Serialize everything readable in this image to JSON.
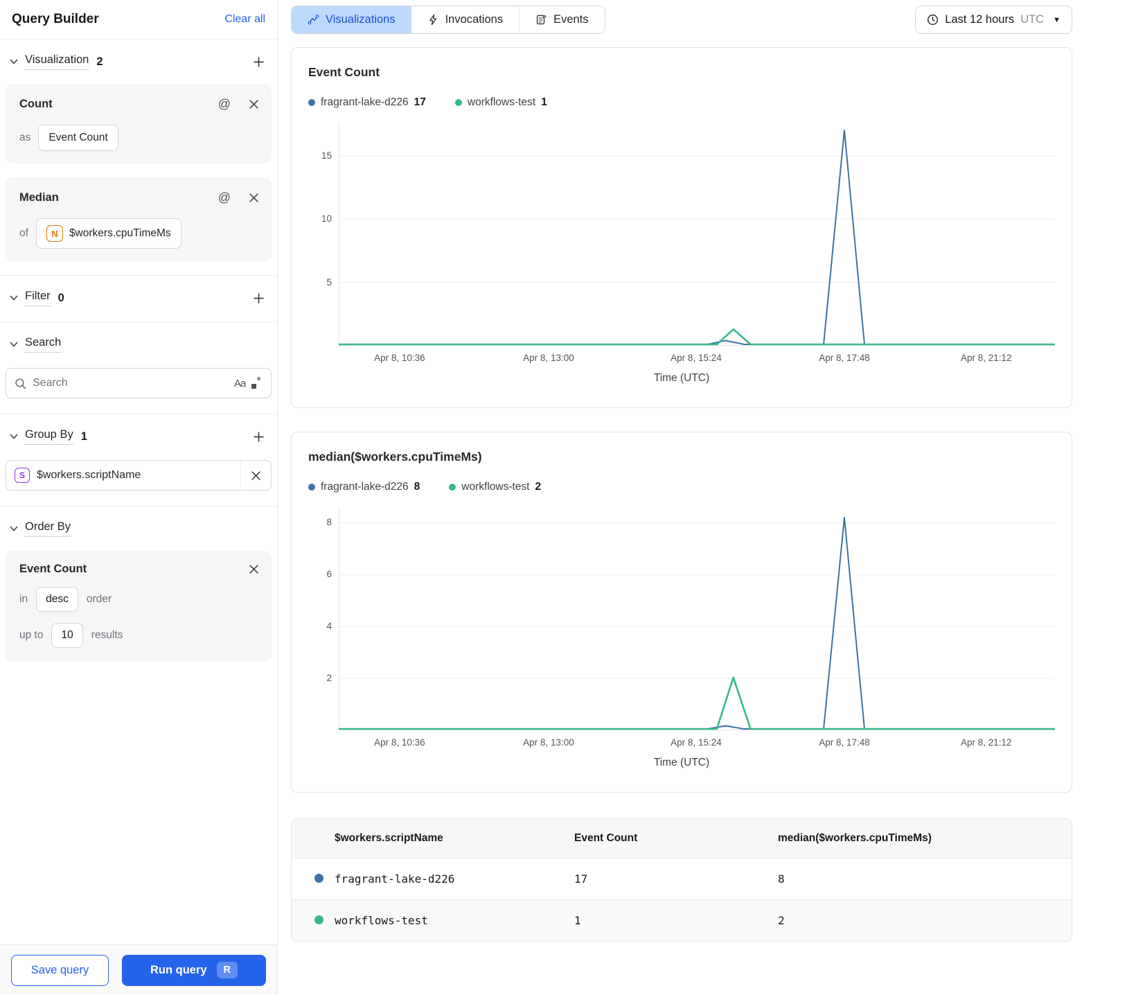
{
  "sidebar": {
    "title": "Query Builder",
    "clear_all": "Clear all",
    "sections": {
      "visualization": {
        "label": "Visualization",
        "count": "2"
      },
      "filter": {
        "label": "Filter",
        "count": "0"
      },
      "search": {
        "label": "Search"
      },
      "group_by": {
        "label": "Group By",
        "count": "1"
      },
      "order_by": {
        "label": "Order By"
      }
    },
    "cards": {
      "count": {
        "title": "Count",
        "as_label": "as",
        "as_value": "Event Count"
      },
      "median": {
        "title": "Median",
        "of_label": "of",
        "icon_letter": "N",
        "field": "$workers.cpuTimeMs"
      }
    },
    "search": {
      "placeholder": "Search",
      "match_case_label": "Aa"
    },
    "group_by_item": {
      "icon_letter": "S",
      "field": "$workers.scriptName"
    },
    "order_card": {
      "title": "Event Count",
      "in_label": "in",
      "direction": "desc",
      "order_label": "order",
      "up_to_label": "up to",
      "limit": "10",
      "results_label": "results"
    },
    "footer": {
      "save": "Save query",
      "run": "Run query",
      "run_shortcut": "R"
    }
  },
  "topbar": {
    "tabs": [
      {
        "label": "Visualizations",
        "icon": "line-chart-icon",
        "active": true
      },
      {
        "label": "Invocations",
        "icon": "lightning-icon",
        "active": false
      },
      {
        "label": "Events",
        "icon": "events-icon",
        "active": false
      }
    ],
    "time_range": {
      "label": "Last 12 hours",
      "timezone": "UTC"
    }
  },
  "colors": {
    "series_blue": "#3d72a6",
    "series_green": "#36b98b",
    "accent_blue": "#2563eb"
  },
  "chart_data": [
    {
      "type": "line",
      "title": "Event Count",
      "xlabel": "Time (UTC)",
      "x_tick_labels": [
        "Apr 8, 10:36",
        "Apr 8, 13:00",
        "Apr 8, 15:24",
        "Apr 8, 17:48",
        "Apr 8, 21:12"
      ],
      "x_tick_pos": [
        0.085,
        0.293,
        0.499,
        0.706,
        0.904
      ],
      "y_ticks": [
        5,
        10,
        15
      ],
      "ylim": [
        0,
        17.6
      ],
      "legend": [
        {
          "name": "fragrant-lake-d226",
          "value": "17",
          "color": "#3d72a6"
        },
        {
          "name": "workflows-test",
          "value": "1",
          "color": "#36b98b"
        }
      ],
      "series": [
        {
          "name": "fragrant-lake-d226",
          "color": "#3d72a6",
          "width": 2,
          "points": [
            [
              0,
              0
            ],
            [
              0.515,
              0
            ],
            [
              0.54,
              0.3
            ],
            [
              0.566,
              0
            ],
            [
              0.677,
              0
            ],
            [
              0.706,
              17
            ],
            [
              0.734,
              0
            ],
            [
              1,
              0
            ]
          ]
        },
        {
          "name": "workflows-test",
          "color": "#36b98b",
          "width": 2.6,
          "points": [
            [
              0,
              0
            ],
            [
              0.528,
              0
            ],
            [
              0.551,
              1.2
            ],
            [
              0.575,
              0
            ],
            [
              1,
              0
            ]
          ]
        }
      ]
    },
    {
      "type": "line",
      "title": "median($workers.cpuTimeMs)",
      "xlabel": "Time (UTC)",
      "x_tick_labels": [
        "Apr 8, 10:36",
        "Apr 8, 13:00",
        "Apr 8, 15:24",
        "Apr 8, 17:48",
        "Apr 8, 21:12"
      ],
      "x_tick_pos": [
        0.085,
        0.293,
        0.499,
        0.706,
        0.904
      ],
      "y_ticks": [
        2,
        4,
        6,
        8
      ],
      "ylim": [
        0,
        8.6
      ],
      "legend": [
        {
          "name": "fragrant-lake-d226",
          "value": "8",
          "color": "#3d72a6"
        },
        {
          "name": "workflows-test",
          "value": "2",
          "color": "#36b98b"
        }
      ],
      "series": [
        {
          "name": "fragrant-lake-d226",
          "color": "#3d72a6",
          "width": 2,
          "points": [
            [
              0,
              0
            ],
            [
              0.515,
              0
            ],
            [
              0.54,
              0.12
            ],
            [
              0.566,
              0
            ],
            [
              0.677,
              0
            ],
            [
              0.706,
              8.2
            ],
            [
              0.734,
              0
            ],
            [
              1,
              0
            ]
          ]
        },
        {
          "name": "workflows-test",
          "color": "#36b98b",
          "width": 2.6,
          "points": [
            [
              0,
              0
            ],
            [
              0.528,
              0
            ],
            [
              0.551,
              2
            ],
            [
              0.575,
              0
            ],
            [
              1,
              0
            ]
          ]
        }
      ]
    }
  ],
  "table": {
    "headers": [
      "$workers.scriptName",
      "Event Count",
      "median($workers.cpuTimeMs)"
    ],
    "rows": [
      {
        "color": "#3d72a6",
        "name": "fragrant-lake-d226",
        "event_count": "17",
        "median": "8"
      },
      {
        "color": "#36b98b",
        "name": "workflows-test",
        "event_count": "1",
        "median": "2"
      }
    ]
  }
}
